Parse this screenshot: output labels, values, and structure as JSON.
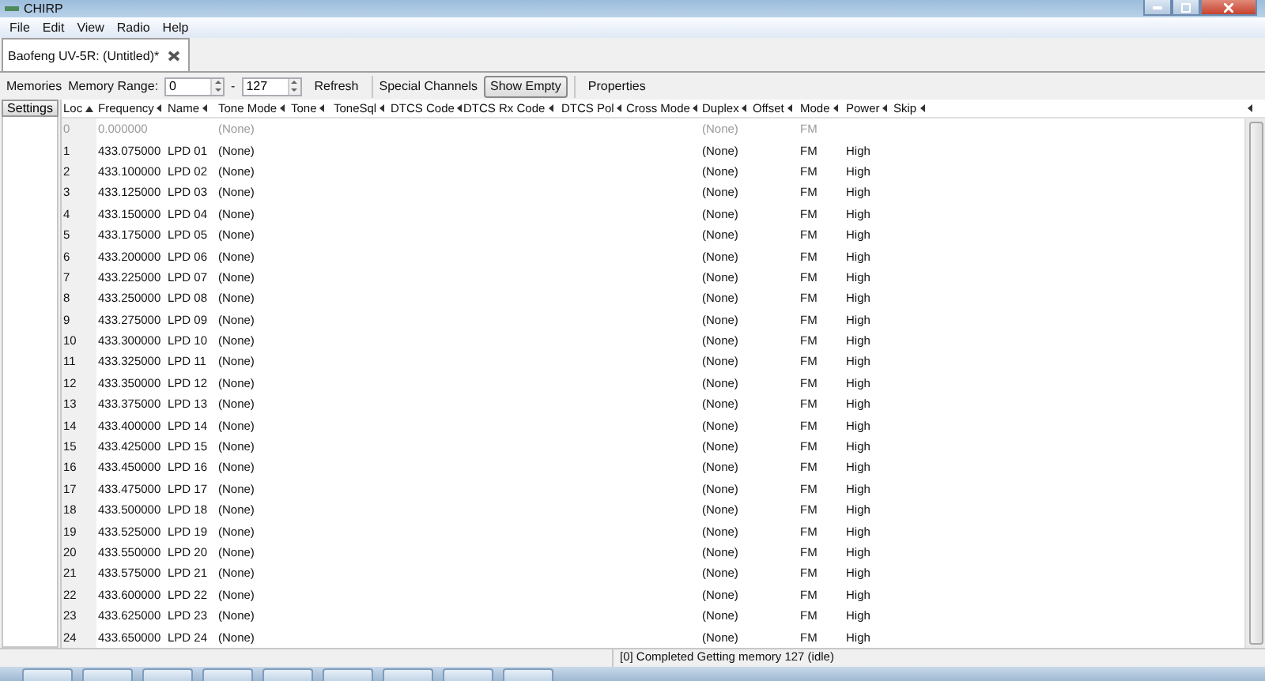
{
  "window": {
    "title": "CHIRP"
  },
  "menu": [
    "File",
    "Edit",
    "View",
    "Radio",
    "Help"
  ],
  "tab": {
    "label": "Baofeng UV-5R: (Untitled)*"
  },
  "toolbar": {
    "memories_label": "Memories",
    "range_label": "Memory Range:",
    "range_from": "0",
    "range_dash": "-",
    "range_to": "127",
    "refresh": "Refresh",
    "special_channels": "Special Channels",
    "show_empty": {
      "label": "Show Empty",
      "selected": true
    },
    "properties": "Properties"
  },
  "sidebar": {
    "settings": "Settings"
  },
  "columns": [
    {
      "label": "Loc",
      "sorted": true
    },
    {
      "label": "Frequency",
      "sorted": false
    },
    {
      "label": "Name",
      "sorted": false
    },
    {
      "label": "Tone Mode",
      "sorted": false
    },
    {
      "label": "Tone",
      "sorted": false
    },
    {
      "label": "ToneSql",
      "sorted": false
    },
    {
      "label": "DTCS Code",
      "sorted": false
    },
    {
      "label": "DTCS Rx Code",
      "sorted": false
    },
    {
      "label": "DTCS Pol",
      "sorted": false
    },
    {
      "label": "Cross Mode",
      "sorted": false
    },
    {
      "label": "Duplex",
      "sorted": false
    },
    {
      "label": "Offset",
      "sorted": false
    },
    {
      "label": "Mode",
      "sorted": false
    },
    {
      "label": "Power",
      "sorted": false
    },
    {
      "label": "Skip",
      "sorted": false
    }
  ],
  "rows": [
    {
      "loc": "0",
      "frequency": "0.000000",
      "tone_mode": "(None)",
      "duplex": "(None)",
      "mode": "FM",
      "empty": true
    },
    {
      "loc": "1",
      "frequency": "433.075000",
      "name": "LPD 01",
      "tone_mode": "(None)",
      "duplex": "(None)",
      "mode": "FM",
      "power": "High",
      "empty": false
    },
    {
      "loc": "2",
      "frequency": "433.100000",
      "name": "LPD 02",
      "tone_mode": "(None)",
      "duplex": "(None)",
      "mode": "FM",
      "power": "High",
      "empty": false
    },
    {
      "loc": "3",
      "frequency": "433.125000",
      "name": "LPD 03",
      "tone_mode": "(None)",
      "duplex": "(None)",
      "mode": "FM",
      "power": "High",
      "empty": false
    },
    {
      "loc": "4",
      "frequency": "433.150000",
      "name": "LPD 04",
      "tone_mode": "(None)",
      "duplex": "(None)",
      "mode": "FM",
      "power": "High",
      "empty": false
    },
    {
      "loc": "5",
      "frequency": "433.175000",
      "name": "LPD 05",
      "tone_mode": "(None)",
      "duplex": "(None)",
      "mode": "FM",
      "power": "High",
      "empty": false
    },
    {
      "loc": "6",
      "frequency": "433.200000",
      "name": "LPD 06",
      "tone_mode": "(None)",
      "duplex": "(None)",
      "mode": "FM",
      "power": "High",
      "empty": false
    },
    {
      "loc": "7",
      "frequency": "433.225000",
      "name": "LPD 07",
      "tone_mode": "(None)",
      "duplex": "(None)",
      "mode": "FM",
      "power": "High",
      "empty": false
    },
    {
      "loc": "8",
      "frequency": "433.250000",
      "name": "LPD 08",
      "tone_mode": "(None)",
      "duplex": "(None)",
      "mode": "FM",
      "power": "High",
      "empty": false
    },
    {
      "loc": "9",
      "frequency": "433.275000",
      "name": "LPD 09",
      "tone_mode": "(None)",
      "duplex": "(None)",
      "mode": "FM",
      "power": "High",
      "empty": false
    },
    {
      "loc": "10",
      "frequency": "433.300000",
      "name": "LPD 10",
      "tone_mode": "(None)",
      "duplex": "(None)",
      "mode": "FM",
      "power": "High",
      "empty": false
    },
    {
      "loc": "11",
      "frequency": "433.325000",
      "name": "LPD 11",
      "tone_mode": "(None)",
      "duplex": "(None)",
      "mode": "FM",
      "power": "High",
      "empty": false
    },
    {
      "loc": "12",
      "frequency": "433.350000",
      "name": "LPD 12",
      "tone_mode": "(None)",
      "duplex": "(None)",
      "mode": "FM",
      "power": "High",
      "empty": false
    },
    {
      "loc": "13",
      "frequency": "433.375000",
      "name": "LPD 13",
      "tone_mode": "(None)",
      "duplex": "(None)",
      "mode": "FM",
      "power": "High",
      "empty": false
    },
    {
      "loc": "14",
      "frequency": "433.400000",
      "name": "LPD 14",
      "tone_mode": "(None)",
      "duplex": "(None)",
      "mode": "FM",
      "power": "High",
      "empty": false
    },
    {
      "loc": "15",
      "frequency": "433.425000",
      "name": "LPD 15",
      "tone_mode": "(None)",
      "duplex": "(None)",
      "mode": "FM",
      "power": "High",
      "empty": false
    },
    {
      "loc": "16",
      "frequency": "433.450000",
      "name": "LPD 16",
      "tone_mode": "(None)",
      "duplex": "(None)",
      "mode": "FM",
      "power": "High",
      "empty": false
    },
    {
      "loc": "17",
      "frequency": "433.475000",
      "name": "LPD 17",
      "tone_mode": "(None)",
      "duplex": "(None)",
      "mode": "FM",
      "power": "High",
      "empty": false
    },
    {
      "loc": "18",
      "frequency": "433.500000",
      "name": "LPD 18",
      "tone_mode": "(None)",
      "duplex": "(None)",
      "mode": "FM",
      "power": "High",
      "empty": false
    },
    {
      "loc": "19",
      "frequency": "433.525000",
      "name": "LPD 19",
      "tone_mode": "(None)",
      "duplex": "(None)",
      "mode": "FM",
      "power": "High",
      "empty": false
    },
    {
      "loc": "20",
      "frequency": "433.550000",
      "name": "LPD 20",
      "tone_mode": "(None)",
      "duplex": "(None)",
      "mode": "FM",
      "power": "High",
      "empty": false
    },
    {
      "loc": "21",
      "frequency": "433.575000",
      "name": "LPD 21",
      "tone_mode": "(None)",
      "duplex": "(None)",
      "mode": "FM",
      "power": "High",
      "empty": false
    },
    {
      "loc": "22",
      "frequency": "433.600000",
      "name": "LPD 22",
      "tone_mode": "(None)",
      "duplex": "(None)",
      "mode": "FM",
      "power": "High",
      "empty": false
    },
    {
      "loc": "23",
      "frequency": "433.625000",
      "name": "LPD 23",
      "tone_mode": "(None)",
      "duplex": "(None)",
      "mode": "FM",
      "power": "High",
      "empty": false
    },
    {
      "loc": "24",
      "frequency": "433.650000",
      "name": "LPD 24",
      "tone_mode": "(None)",
      "duplex": "(None)",
      "mode": "FM",
      "power": "High",
      "empty": false
    }
  ],
  "status_bar": {
    "message": "[0] Completed Getting memory 127 (idle)"
  }
}
